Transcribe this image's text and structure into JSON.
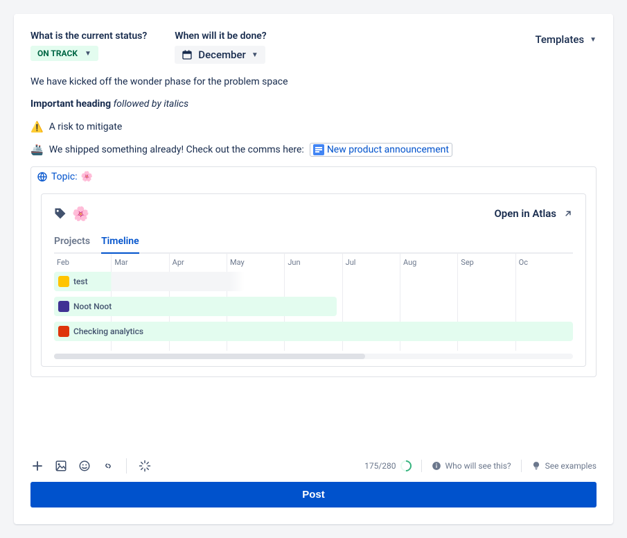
{
  "header": {
    "status_question": "What is the current status?",
    "date_question": "When will it be done?",
    "status_value": "ON TRACK",
    "date_value": "December",
    "templates_label": "Templates"
  },
  "content": {
    "line1": "We have kicked off the wonder phase for the problem space",
    "bold": "Important heading",
    "italic": "followed by italics",
    "risk_emoji": "⚠️",
    "risk_text": "A risk to mitigate",
    "ship_emoji": "🚢",
    "ship_text": "We shipped something already! Check out the comms here:",
    "doc_link": "New product announcement"
  },
  "embed": {
    "topic_prefix": "Topic:",
    "topic_emoji": "🌸",
    "open_label": "Open in Atlas",
    "tabs": {
      "projects": "Projects",
      "timeline": "Timeline"
    }
  },
  "chart_data": {
    "type": "bar",
    "categories": [
      "Feb",
      "Mar",
      "Apr",
      "May",
      "Jun",
      "Jul",
      "Aug",
      "Sep",
      "Oc"
    ],
    "series": [
      {
        "name": "test",
        "icon_color": "#ffc400",
        "start": 0,
        "end": 3.3,
        "is_partial_gray": true
      },
      {
        "name": "Noot Noot",
        "icon_color": "#403294",
        "start": 0,
        "end": 4.9
      },
      {
        "name": "Checking analytics",
        "icon_color": "#de350b",
        "start": 0,
        "end": 9
      }
    ]
  },
  "footer": {
    "char_count": "175/280",
    "who_sees": "Who will see this?",
    "examples": "See examples",
    "post": "Post"
  }
}
